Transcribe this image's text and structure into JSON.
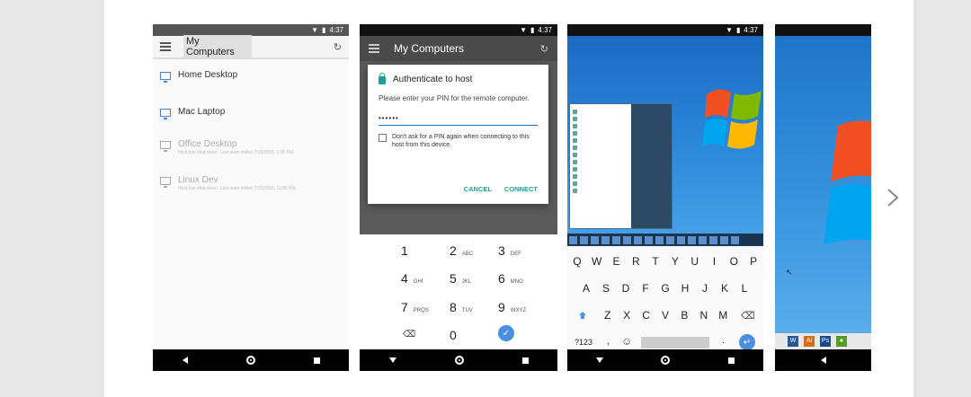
{
  "status": {
    "time": "4:37"
  },
  "shot1": {
    "title": "My Computers",
    "hosts": [
      {
        "name": "Home Desktop",
        "status": ""
      },
      {
        "name": "Mac Laptop",
        "status": ""
      },
      {
        "name": "Office Desktop",
        "status": "Host has shut down. Last seen online 7/15/2015, 1:05 PM."
      },
      {
        "name": "Linux Dev",
        "status": "Host has shut down. Last seen online 7/12/2015, 11:56 PM."
      }
    ]
  },
  "shot2": {
    "title": "My Computers",
    "dialog": {
      "title": "Authenticate to host",
      "message": "Please enter your PIN for the remote computer.",
      "pin": "••••••",
      "checkbox": "Don't ask for a PIN again when connecting to this host from this device.",
      "cancel": "CANCEL",
      "connect": "CONNECT"
    },
    "keypad": [
      {
        "d": "1",
        "l": ""
      },
      {
        "d": "2",
        "l": "ABC"
      },
      {
        "d": "3",
        "l": "DEF"
      },
      {
        "d": "4",
        "l": "GHI"
      },
      {
        "d": "5",
        "l": "JKL"
      },
      {
        "d": "6",
        "l": "MNO"
      },
      {
        "d": "7",
        "l": "PRQS"
      },
      {
        "d": "8",
        "l": "TUV"
      },
      {
        "d": "9",
        "l": "WXYZ"
      },
      {
        "d": "0",
        "l": ""
      }
    ]
  },
  "shot3": {
    "row1": [
      "Q",
      "W",
      "E",
      "R",
      "T",
      "Y",
      "U",
      "I",
      "O",
      "P"
    ],
    "row2": [
      "A",
      "S",
      "D",
      "F",
      "G",
      "H",
      "J",
      "K",
      "L"
    ],
    "row3": [
      "Z",
      "X",
      "C",
      "V",
      "B",
      "N",
      "M"
    ],
    "sym": "?123",
    "comma": ",",
    "period": ".",
    "emoji": "☺"
  },
  "colors": {
    "accent": "#1aa39a",
    "blue": "#4a90e2"
  },
  "icons": {
    "next": "chevron-right-icon",
    "lock": "lock-icon",
    "monitor": "monitor-icon"
  }
}
